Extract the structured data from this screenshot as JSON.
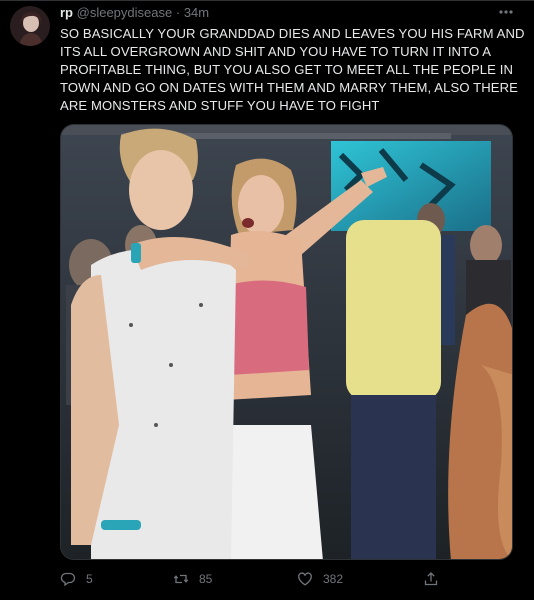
{
  "tweet": {
    "display_name": "rp",
    "handle": "@sleepydisease",
    "separator": "·",
    "time": "34m",
    "text": "SO BASICALLY YOUR GRANDDAD DIES AND LEAVES YOU HIS FARM AND\nITS ALL OVERGROWN AND SHIT AND YOU HAVE TO TURN IT INTO A\nPROFITABLE THING, BUT YOU ALSO GET TO MEET ALL THE PEOPLE IN\nTOWN AND GO ON  DATES WITH THEM AND MARRY THEM, ALSO THERE\nARE MONSTERS AND STUFF YOU HAVE TO FIGHT"
  },
  "actions": {
    "reply_count": "5",
    "retweet_count": "85",
    "like_count": "382"
  },
  "icons": {
    "more": "more-horizontal-icon",
    "reply": "reply-icon",
    "retweet": "retweet-icon",
    "like": "heart-icon",
    "share": "share-icon"
  },
  "colors": {
    "background": "#000000",
    "text": "#e7e9ea",
    "muted": "#71767b"
  }
}
